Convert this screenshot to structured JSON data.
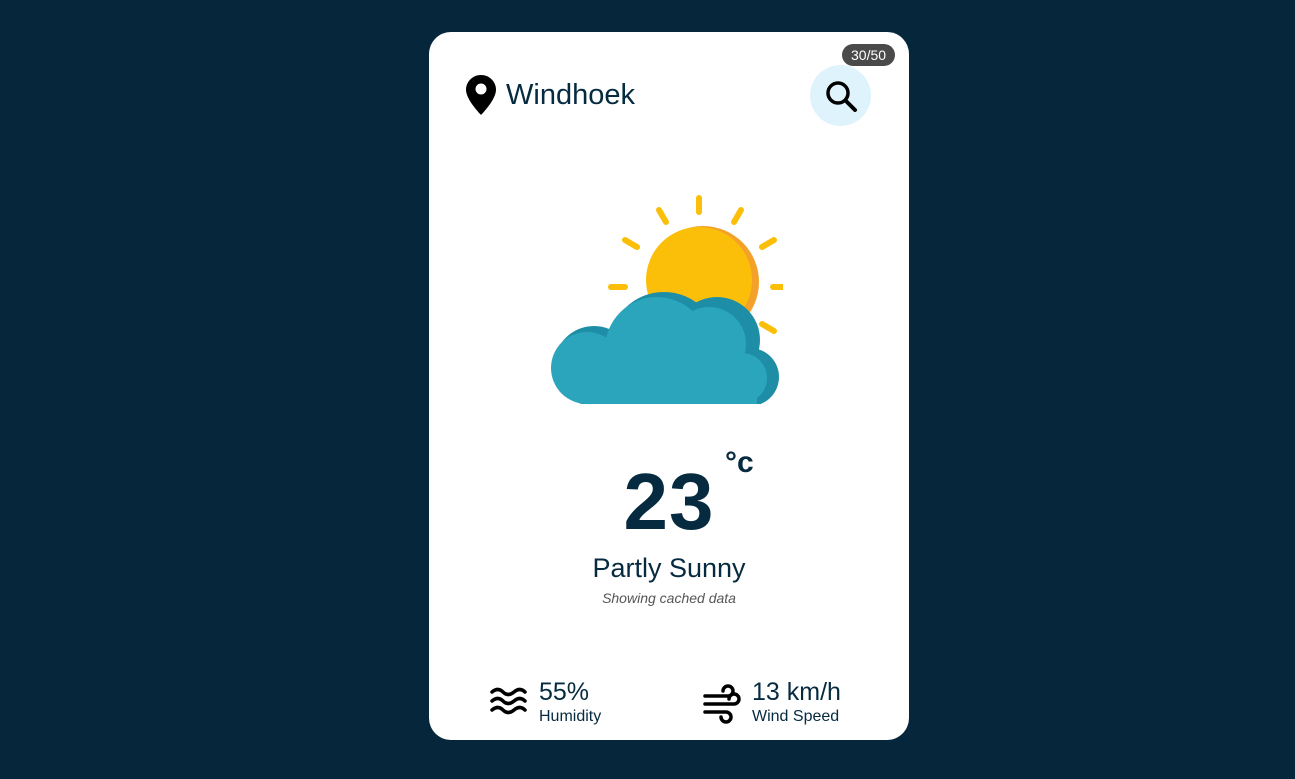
{
  "location": {
    "city": "Windhoek",
    "icon": "map-pin-icon"
  },
  "search": {
    "icon": "search-icon",
    "counter": "30/50"
  },
  "weather": {
    "icon": "partly-sunny-icon",
    "temperature": "23",
    "unit": "°c",
    "condition": "Partly Sunny",
    "note": "Showing cached data"
  },
  "stats": {
    "humidity": {
      "value": "55%",
      "label": "Humidity",
      "icon": "humidity-waves-icon"
    },
    "wind": {
      "value": "13 km/h",
      "label": "Wind Speed",
      "icon": "wind-icon"
    }
  },
  "colors": {
    "background": "#05263b",
    "card": "#ffffff",
    "text": "#062a3f",
    "search_bg": "#dff3fd",
    "badge_bg": "#4a4a4a",
    "sun": "#fbbf0a",
    "sun_shadow": "#f4a12a",
    "cloud": "#2aa5bc",
    "cloud_shadow": "#1e8ea6"
  }
}
